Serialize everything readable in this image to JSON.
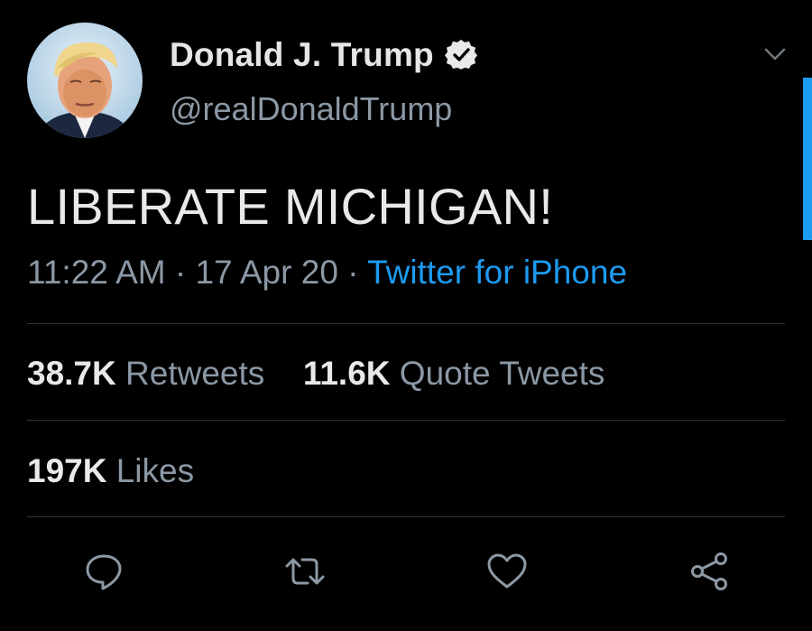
{
  "author": {
    "display_name": "Donald J. Trump",
    "handle": "@realDonaldTrump",
    "verified": true,
    "avatar_icon": "profile-photo"
  },
  "tweet": {
    "text": "LIBERATE MICHIGAN!",
    "time": "11:22 AM",
    "separator": "·",
    "date": "17 Apr 20",
    "source": "Twitter for iPhone"
  },
  "stats": {
    "retweets_count": "38.7K",
    "retweets_label": "Retweets",
    "quotes_count": "11.6K",
    "quotes_label": "Quote Tweets",
    "likes_count": "197K",
    "likes_label": "Likes"
  },
  "actions": [
    {
      "name": "reply",
      "icon": "speech-bubble-icon"
    },
    {
      "name": "retweet",
      "icon": "retweet-icon"
    },
    {
      "name": "like",
      "icon": "heart-icon"
    },
    {
      "name": "share",
      "icon": "share-icon"
    }
  ],
  "colors": {
    "background": "#000000",
    "primary_text": "#e7e9ea",
    "secondary_text": "#8b98a5",
    "accent": "#1d9bf0",
    "divider": "#2f3336"
  }
}
